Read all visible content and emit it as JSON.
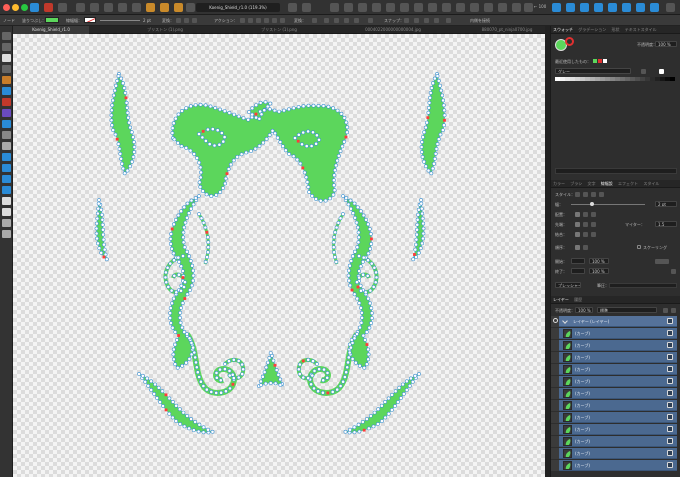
{
  "titlebar": {
    "doc_title": "Koenig_Shield_r1.0 (119.3%)",
    "zoom": "← 100"
  },
  "context_toolbar": {
    "mode": "ノード",
    "fill_label": "塗りつぶし：",
    "stroke_label": "線幅幅：",
    "stroke_width": "2 pt",
    "transform_label": "変換：",
    "action_label": "アクション：",
    "convert_label": "変換：",
    "snap_label": "スナップ：",
    "target": "内側を接続",
    "fill_color": "#5cd65c"
  },
  "doc_tabs": [
    "Koenig_Shield_r1.0",
    "ブリストン (1).png",
    "ブリストン (1).png",
    "0004022000000000004.jpg",
    "880070_pt_ninja0700.jpg"
  ],
  "color_panel": {
    "tabs": [
      "スウォッチ",
      "グラデーション",
      "形状",
      "テキストスタイル"
    ],
    "opacity_label": "不透明度：",
    "opacity": "100 %",
    "recent_label": "最近使用したもの：",
    "palette": "グレー",
    "fill_color": "#5cd65c"
  },
  "stroke_panel": {
    "tabs": [
      "カラー",
      "ブラシ",
      "文字",
      "線幅設",
      "エフェクト",
      "スタイル"
    ],
    "style_label": "スタイル：",
    "width_label": "幅：",
    "width": "2 pt",
    "pos_label": "配置：",
    "cap_label": "先端：",
    "join_label": "結合：",
    "miter_label": "マイター：",
    "miter": "1.5",
    "order_label": "順序：",
    "scaling": "スケーリング",
    "start_label": "開始：",
    "end_label": "終了：",
    "start_pct": "100 %",
    "end_pct": "100 %",
    "pressure": "プレッシャー",
    "pressure_label": "筆圧："
  },
  "layers_panel": {
    "tabs": [
      "レイヤー",
      "履歴"
    ],
    "opacity_label": "不透明度：",
    "opacity": "100 %",
    "blend": "標準",
    "master": "レイヤー (レイヤー)",
    "items": [
      "(カーブ)",
      "(カーブ)",
      "(カーブ)",
      "(カーブ)",
      "(カーブ)",
      "(カーブ)",
      "(カーブ)",
      "(カーブ)",
      "(カーブ)",
      "(カーブ)",
      "(カーブ)",
      "(カーブ)"
    ]
  }
}
